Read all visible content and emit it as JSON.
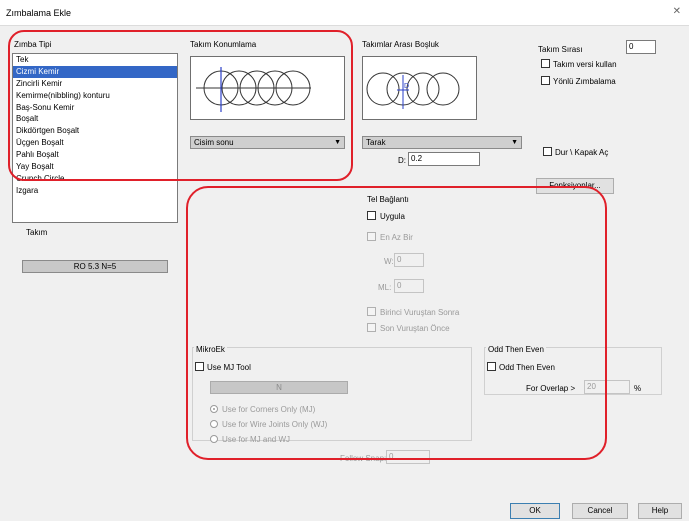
{
  "window": {
    "title": "Zımbalama Ekle",
    "close_icon": "close-icon"
  },
  "zimba_tipi": {
    "label": "Zımba Tipi",
    "items": [
      {
        "label": "Tek",
        "selected": false
      },
      {
        "label": "Cizmi Kemir",
        "selected": true
      },
      {
        "label": "Zincirli Kemir",
        "selected": false
      },
      {
        "label": "Kemirme(nibbling) konturu",
        "selected": false
      },
      {
        "label": "Baş-Sonu Kemir",
        "selected": false
      },
      {
        "label": "Boşalt",
        "selected": false
      },
      {
        "label": "Dikdörtgen Boşalt",
        "selected": false
      },
      {
        "label": "Üçgen Boşalt",
        "selected": false
      },
      {
        "label": "Pahlı Boşalt",
        "selected": false
      },
      {
        "label": "Yay Boşalt",
        "selected": false
      },
      {
        "label": "Crunch Circle",
        "selected": false
      },
      {
        "label": "Izgara",
        "selected": false
      }
    ]
  },
  "takim": {
    "label": "Takım",
    "tool_button": "RO 5.3 N=5"
  },
  "takim_konumlama": {
    "label": "Takım Konumlama",
    "combo_value": "Cisim sonu"
  },
  "takimlar_arasi": {
    "label": "Takımlar Arası Boşluk",
    "combo_value": "Tarak",
    "d_label": "D:",
    "d_value": "0.2"
  },
  "takim_sirasi": {
    "label": "Takım Sırası",
    "value": "0",
    "cb1": "Takım versi kullan",
    "cb2": "Yönlü Zımbalama"
  },
  "dur_kapak": "Dur \\ Kapak Aç",
  "fonksiyonlar_button": "Fonksiyonlar...",
  "tel_baglanti": {
    "label": "Tel Bağlantı",
    "uygula": "Uygula",
    "en_az_bir": "En Az Bir",
    "w_label": "W:",
    "w_value": "0",
    "ml_label": "ML:",
    "ml_value": "0",
    "birinci": "Birinci Vuruştan Sonra",
    "son": "Son Vuruştan Önce"
  },
  "mikroek": {
    "label": "MikroEk",
    "use_mj": "Use MJ Tool",
    "bar_text": "N",
    "radios": [
      "Use for Corners Only (MJ)",
      "Use for Wire Joints Only (WJ)",
      "Use for MJ and WJ"
    ]
  },
  "odd_then_even": {
    "label": "Odd Then Even",
    "checkbox": "Odd Then Even",
    "overlap_label": "For Overlap >",
    "overlap_value": "20",
    "unit": "%"
  },
  "bottom_field": {
    "label": "Follow Snap:",
    "value": "0"
  },
  "buttons": {
    "ok": "OK",
    "cancel": "Cancel",
    "help": "Help"
  },
  "annotation_color": "#e0202a",
  "selection_color": "#3367c6"
}
